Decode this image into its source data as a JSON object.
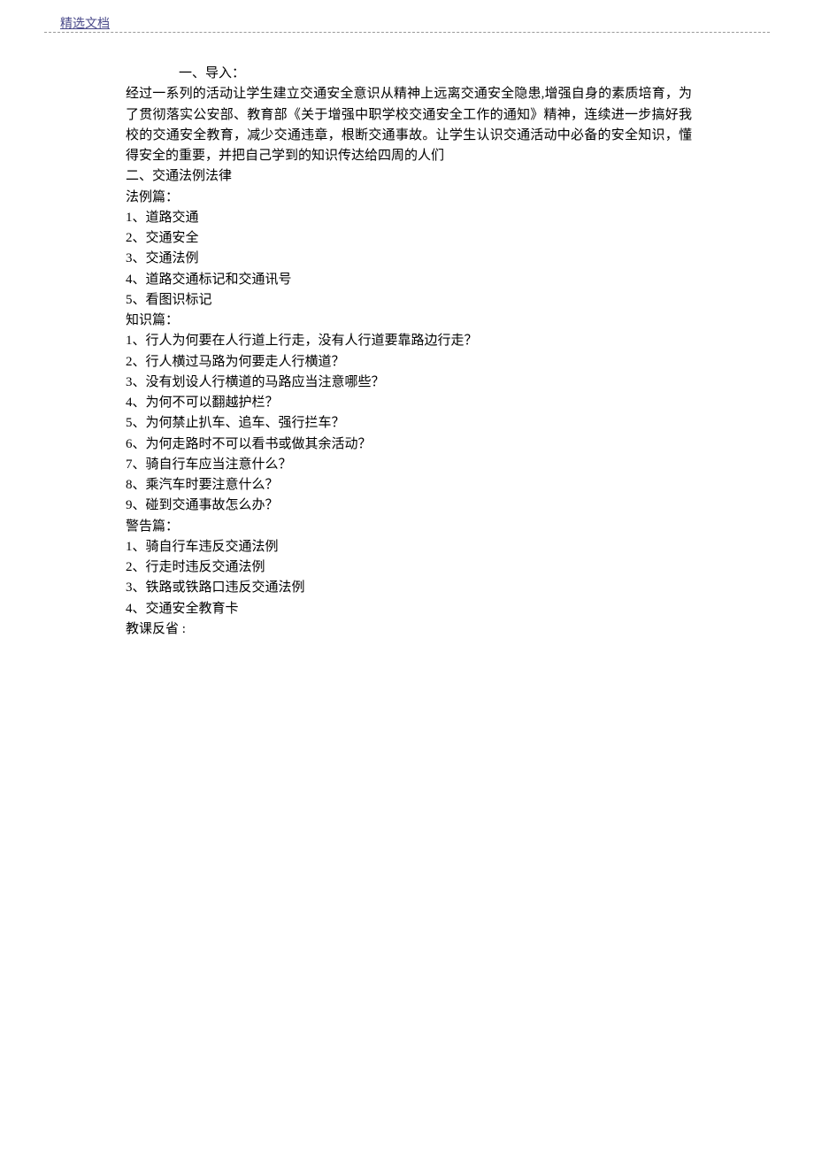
{
  "header": {
    "link": "精选文档"
  },
  "section1": {
    "heading": "一、导入：",
    "paragraph": "经过一系列的活动让学生建立交通安全意识从精神上远离交通安全隐患,增强自身的素质培育，为了贯彻落实公安部、教育部《关于增强中职学校交通安全工作的通知》精神，连续进一步搞好我校的交通安全教育，减少交通违章，根断交通事故。让学生认识交通活动中必备的安全知识，懂得安全的重要，并把自己学到的知识传达给四周的人们"
  },
  "section2": {
    "heading": "二、交通法例法律",
    "sub1": {
      "title": "法例篇：",
      "items": [
        "1、道路交通",
        "2、交通安全",
        "3、交通法例",
        "4、道路交通标记和交通讯号",
        "5、看图识标记"
      ]
    },
    "sub2": {
      "title": "知识篇：",
      "items": [
        "1、行人为何要在人行道上行走，没有人行道要靠路边行走？",
        "2、行人横过马路为何要走人行横道？",
        "3、没有划设人行横道的马路应当注意哪些？",
        "4、为何不可以翻越护栏？",
        "5、为何禁止扒车、追车、强行拦车？",
        "6、为何走路时不可以看书或做其余活动？",
        "7、骑自行车应当注意什么？",
        "8、乘汽车时要注意什么？",
        "9、碰到交通事故怎么办？"
      ]
    },
    "sub3": {
      "title": "警告篇：",
      "items": [
        "1、骑自行车违反交通法例",
        "2、行走时违反交通法例",
        "3、铁路或铁路口违反交通法例",
        "4、交通安全教育卡"
      ]
    }
  },
  "footer": {
    "label": "教课反省 :"
  }
}
